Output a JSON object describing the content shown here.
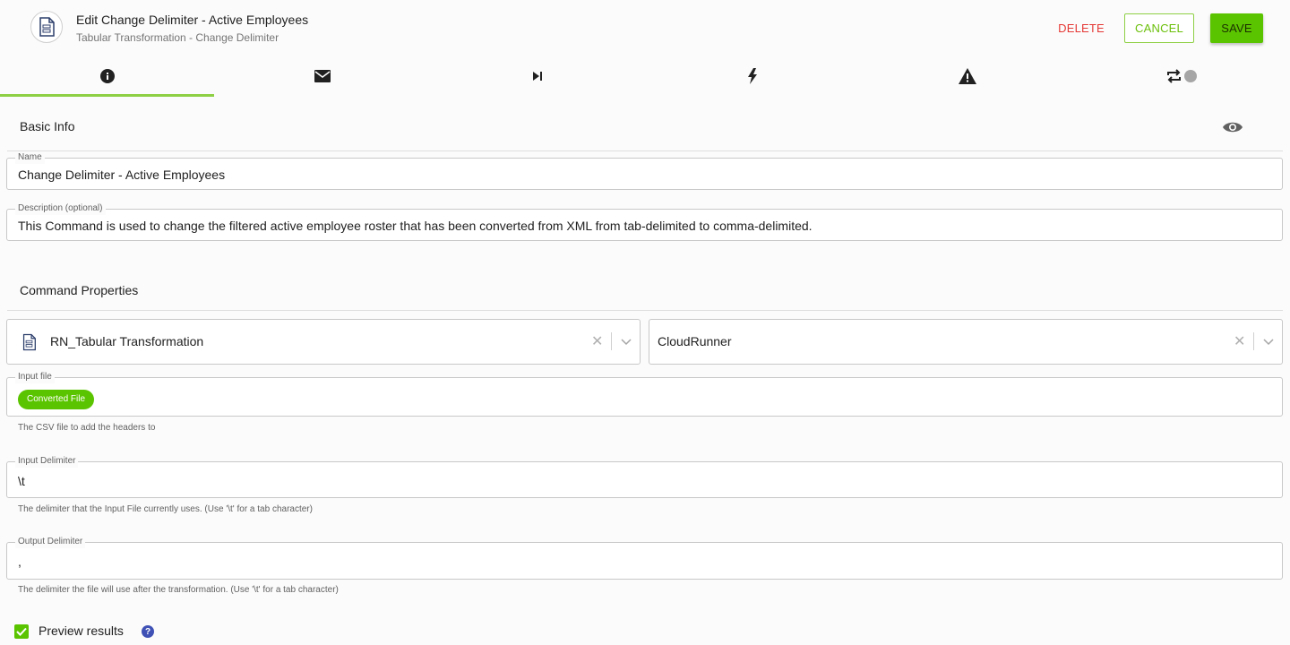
{
  "header": {
    "logo_icon": "tabular-file-icon",
    "title": "Edit Change Delimiter - Active Employees",
    "subtitle": "Tabular Transformation - Change Delimiter",
    "delete_label": "DELETE",
    "cancel_label": "CANCEL",
    "save_label": "SAVE"
  },
  "tabs": [
    {
      "icon": "info-icon",
      "active": true
    },
    {
      "icon": "mail-icon",
      "active": false
    },
    {
      "icon": "skip-next-icon",
      "active": false
    },
    {
      "icon": "lightning-icon",
      "active": false
    },
    {
      "icon": "warning-icon",
      "active": false
    },
    {
      "icon": "repeat-icon",
      "active": false
    }
  ],
  "basic_info": {
    "title": "Basic Info",
    "name": {
      "label": "Name",
      "value": "Change Delimiter - Active Employees"
    },
    "description": {
      "label": "Description (optional)",
      "value": "This Command is used to change the filtered active employee roster that has been converted from XML from tab-delimited to comma-delimited."
    }
  },
  "command_properties": {
    "title": "Command Properties",
    "command_select": {
      "value": "RN_Tabular Transformation",
      "icon": "tabular-file-icon"
    },
    "runner_select": {
      "value": "CloudRunner"
    },
    "input_file": {
      "label": "Input file",
      "chip": "Converted File",
      "helper": "The CSV file to add the headers to"
    },
    "input_delimiter": {
      "label": "Input Delimiter",
      "value": "\\t",
      "helper": "The delimiter that the Input File currently uses. (Use '\\t' for a tab character)"
    },
    "output_delimiter": {
      "label": "Output Delimiter",
      "value": ",",
      "helper": "The delimiter the file will use after the transformation. (Use '\\t' for a tab character)"
    }
  },
  "preview": {
    "label": "Preview results",
    "checked": true
  },
  "colors": {
    "accent": "#5bc400",
    "delete": "#e53935",
    "help": "#3f51b5"
  }
}
